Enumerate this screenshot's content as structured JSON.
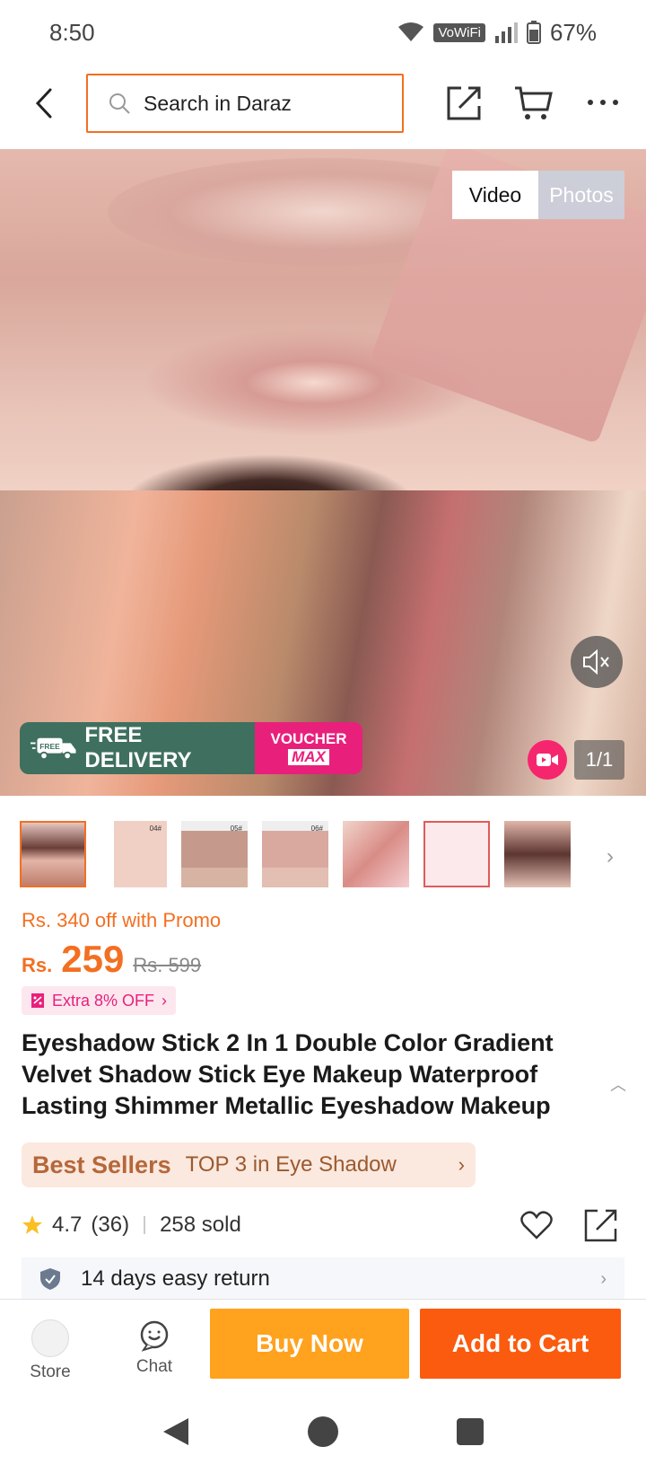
{
  "status": {
    "time": "8:50",
    "network": "VoWiFi",
    "battery": "67%"
  },
  "header": {
    "search_placeholder": "Search in Daraz"
  },
  "media": {
    "tabs": [
      "Video",
      "Photos"
    ],
    "active_tab": "Video",
    "free_delivery": "FREE DELIVERY",
    "free_tag": "FREE",
    "voucher_line1": "VOUCHER",
    "voucher_line2": "MAX",
    "counter": "1/1"
  },
  "thumbnails": [
    {
      "label": "",
      "selected": true
    },
    {
      "label": "04#",
      "selected": false
    },
    {
      "label": "05#",
      "selected": false
    },
    {
      "label": "06#",
      "selected": false
    },
    {
      "label": "",
      "selected": false
    },
    {
      "label": "",
      "selected": false
    },
    {
      "label": "",
      "selected": false
    }
  ],
  "price": {
    "promo_text": "Rs. 340 off with Promo",
    "currency": "Rs.",
    "current": "259",
    "original": "Rs. 599",
    "extra_off": "Extra 8% OFF"
  },
  "product": {
    "title": "Eyeshadow Stick 2 In 1 Double Color Gradient Velvet Shadow Stick Eye Makeup Waterproof Lasting Shimmer Metallic Eyeshadow Makeup"
  },
  "best_sellers": {
    "title": "Best Sellers",
    "text": "TOP 3 in Eye Shadow"
  },
  "rating": {
    "score": "4.7",
    "count": "(36)",
    "sold": "258 sold"
  },
  "returns": {
    "text": "14 days easy return"
  },
  "action_bar": {
    "store": "Store",
    "chat": "Chat",
    "buy_now": "Buy Now",
    "add_to_cart": "Add to Cart"
  },
  "colors": {
    "brand_orange": "#f36f21",
    "buy_now": "#ffa21e",
    "add_to_cart": "#fa5b0f",
    "voucher_pink": "#e8207c",
    "delivery_green": "#3f6f5f"
  }
}
